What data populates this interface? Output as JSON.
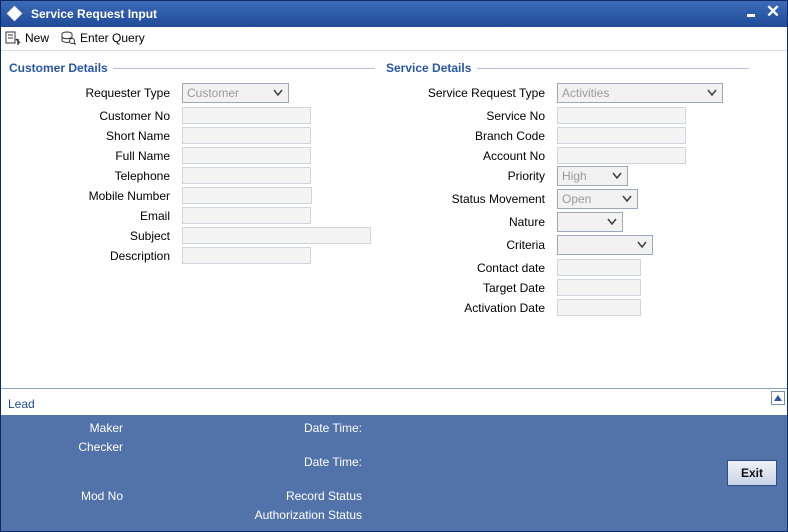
{
  "window": {
    "title": "Service Request Input"
  },
  "toolbar": {
    "new_label": "New",
    "enter_query_label": "Enter Query"
  },
  "customer_details": {
    "title": "Customer Details",
    "requester_type_label": "Requester Type",
    "requester_type_value": "Customer",
    "customer_no_label": "Customer No",
    "short_name_label": "Short Name",
    "full_name_label": "Full Name",
    "telephone_label": "Telephone",
    "mobile_number_label": "Mobile Number",
    "email_label": "Email",
    "subject_label": "Subject",
    "description_label": "Description"
  },
  "service_details": {
    "title": "Service Details",
    "service_request_type_label": "Service Request Type",
    "service_request_type_value": "Activities",
    "service_no_label": "Service No",
    "branch_code_label": "Branch Code",
    "account_no_label": "Account No",
    "priority_label": "Priority",
    "priority_value": "High",
    "status_movement_label": "Status Movement",
    "status_movement_value": "Open",
    "nature_label": "Nature",
    "nature_value": "",
    "criteria_label": "Criteria",
    "criteria_value": "",
    "contact_date_label": "Contact date",
    "target_date_label": "Target Date",
    "activation_date_label": "Activation Date"
  },
  "lead_bar": {
    "label": "Lead"
  },
  "footer": {
    "maker_label": "Maker",
    "checker_label": "Checker",
    "date_time_label_1": "Date Time:",
    "date_time_label_2": "Date Time:",
    "mod_no_label": "Mod No",
    "record_status_label": "Record Status",
    "authorization_status_label": "Authorization Status",
    "exit_label": "Exit"
  },
  "colors": {
    "title_bar": "#2a58a8",
    "section_title": "#2a56a6",
    "footer_bg": "#5272aa"
  }
}
